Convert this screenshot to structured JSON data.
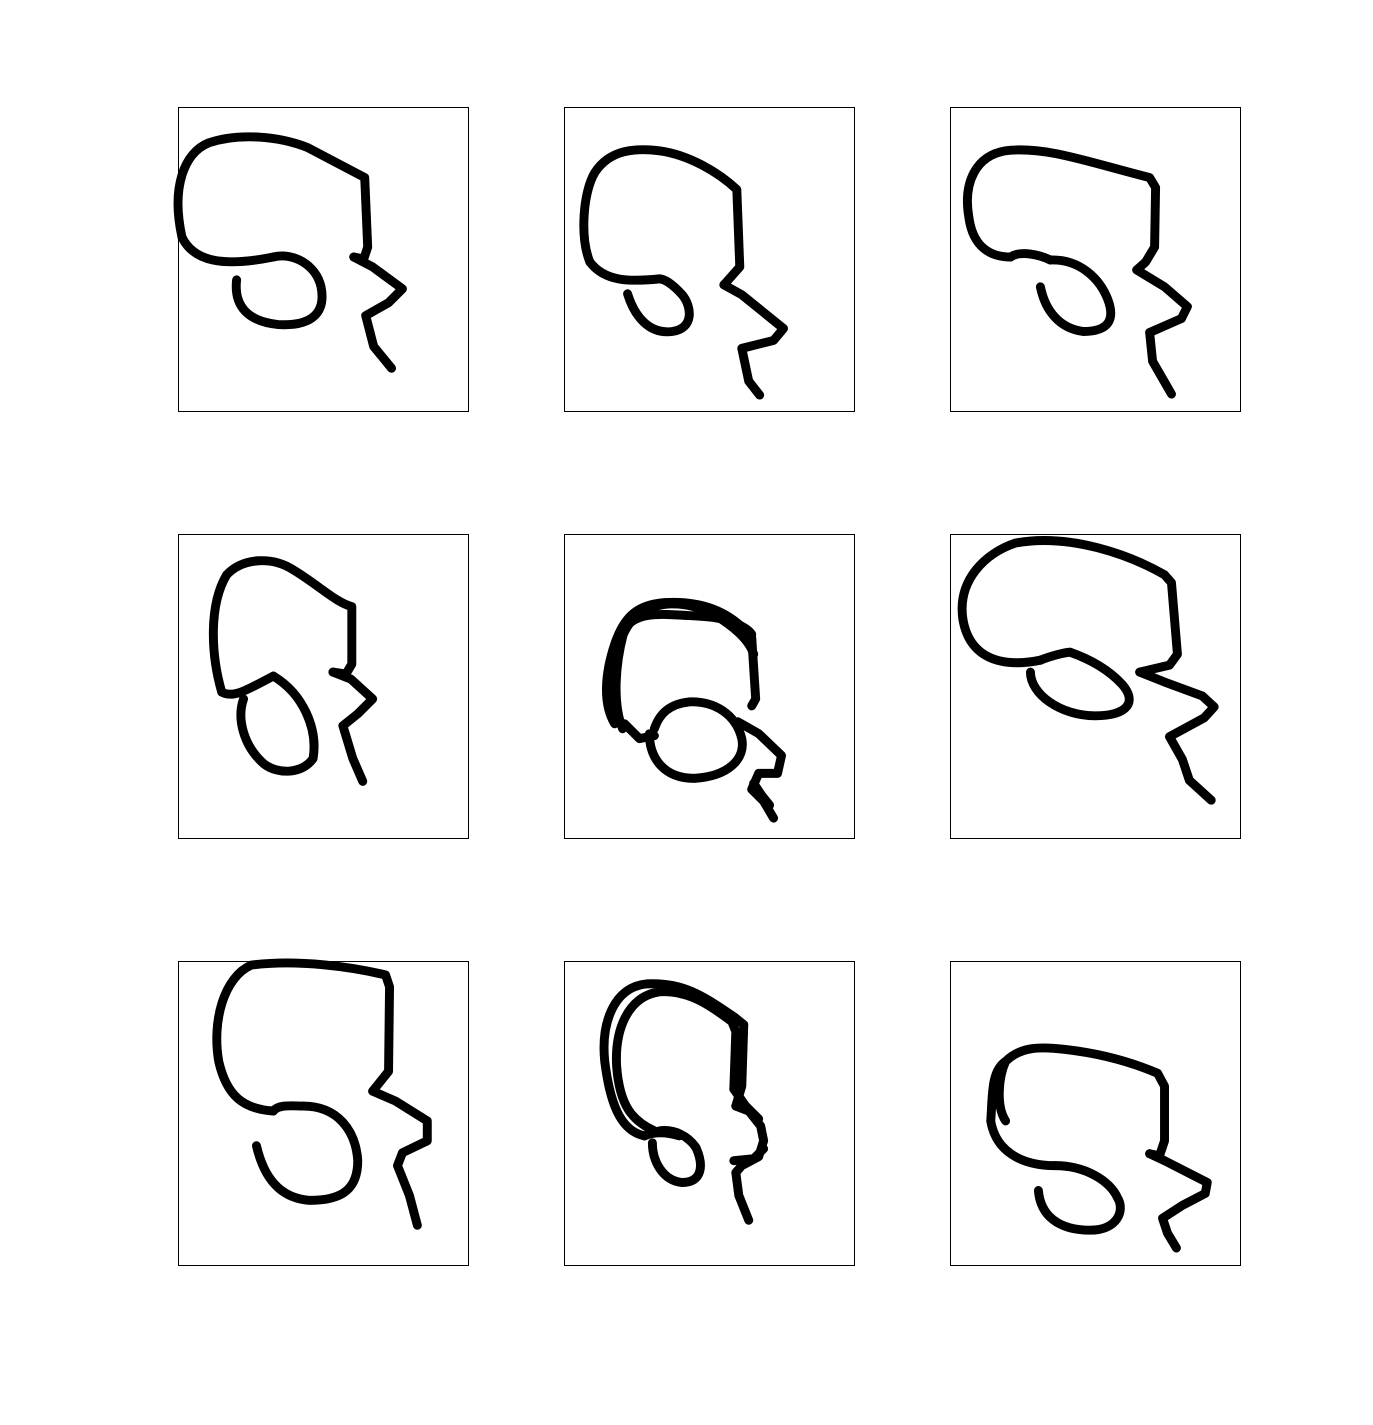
{
  "figure": {
    "panel_count": 9,
    "colors": {
      "stroke": "#000000",
      "frame": "#000000",
      "background": "#ffffff"
    },
    "panels": [
      {
        "content": "hand-drawn-sketch"
      },
      {
        "content": "hand-drawn-sketch"
      },
      {
        "content": "hand-drawn-sketch"
      },
      {
        "content": "hand-drawn-sketch"
      },
      {
        "content": "hand-drawn-sketch"
      },
      {
        "content": "hand-drawn-sketch"
      },
      {
        "content": "hand-drawn-sketch"
      },
      {
        "content": "hand-drawn-sketch"
      },
      {
        "content": "hand-drawn-sketch"
      }
    ]
  }
}
